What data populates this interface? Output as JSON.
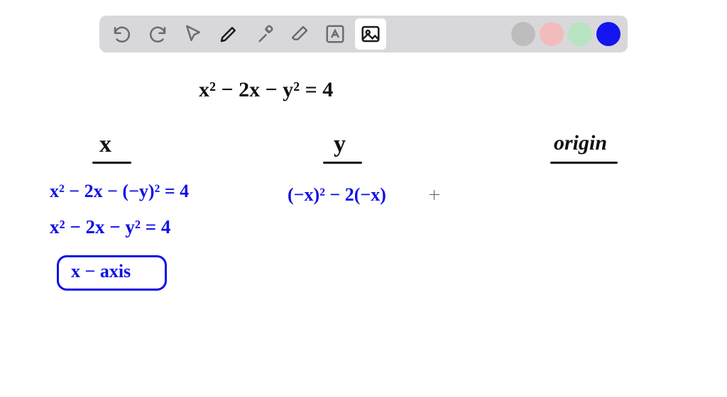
{
  "toolbar": {
    "tools": [
      "undo",
      "redo",
      "pointer",
      "pen",
      "tools",
      "eraser",
      "text",
      "image"
    ],
    "active_tool": "pen",
    "image_selected": true,
    "swatches": [
      "#bdbdbd",
      "#f3bcbc",
      "#b7e3c0",
      "#1414f0"
    ],
    "selected_swatch": 3
  },
  "handwriting": {
    "equation": "x² − 2x − y² = 4",
    "col_x_header": "x",
    "col_y_header": "y",
    "col_origin_header": "origin",
    "x_line1": "x² − 2x − (−y)² = 4",
    "x_line2": "x² − 2x − y² = 4",
    "x_boxed": "x − axis",
    "y_line1": "(−x)² − 2(−x)"
  },
  "colors": {
    "ink_black": "#121212",
    "ink_blue": "#1010e8"
  }
}
